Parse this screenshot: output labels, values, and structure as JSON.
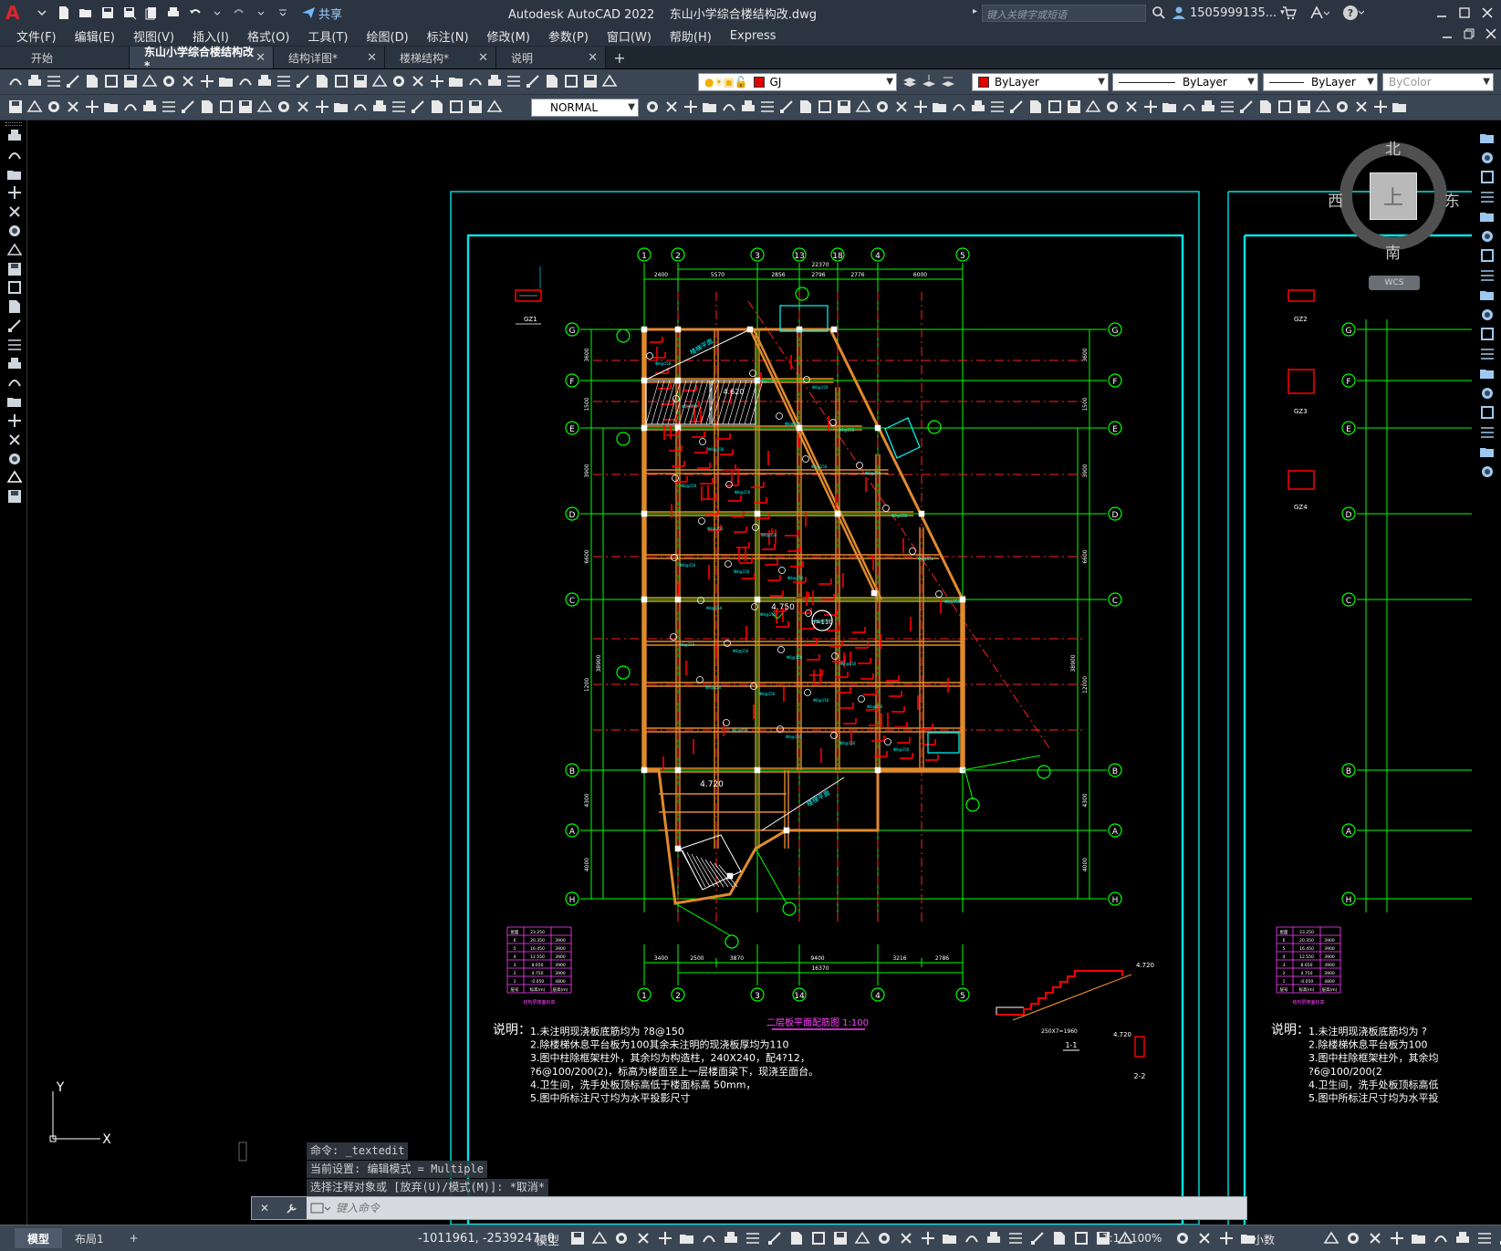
{
  "window": {
    "app_letter": "A",
    "title": "Autodesk AutoCAD 2022    东山小学综合楼结构改.dwg",
    "search_placeholder": "键入关键字或短语",
    "user": "1505999135...",
    "share": "共享"
  },
  "menu": [
    "文件(F)",
    "编辑(E)",
    "视图(V)",
    "插入(I)",
    "格式(O)",
    "工具(T)",
    "绘图(D)",
    "标注(N)",
    "修改(M)",
    "参数(P)",
    "窗口(W)",
    "帮助(H)",
    "Express"
  ],
  "tabs": [
    {
      "label": "开始",
      "active": false,
      "closable": false
    },
    {
      "label": "东山小学综合楼结构改*",
      "active": true,
      "closable": true
    },
    {
      "label": "结构详图*",
      "active": false,
      "closable": true
    },
    {
      "label": "楼梯结构*",
      "active": false,
      "closable": true
    },
    {
      "label": "说明",
      "active": false,
      "closable": true
    }
  ],
  "toolbar": {
    "layer": "GJ",
    "color": "ByLayer",
    "linetype": "ByLayer",
    "lineweight": "ByLayer",
    "plotstyle": "ByColor",
    "dimstyle": "NORMAL"
  },
  "colors": {
    "frame_cyan": "#00e5e5",
    "grid_green": "#00ff00",
    "beam_orange": "#e08a2c",
    "axis_red": "#ff2020",
    "rebar_red": "#ff0000",
    "annot_cyan": "#00ffff",
    "table_magenta": "#ff40ff",
    "note_white": "#ffffff"
  },
  "viewcube": {
    "north": "北",
    "south": "南",
    "east": "东",
    "west": "西",
    "top": "上",
    "wcs": "WCS"
  },
  "drawing": {
    "title": "二层板平面配筋图  1:100",
    "grid_top": [
      "1",
      "2",
      "3",
      "13",
      "18",
      "4",
      "5"
    ],
    "grid_bottom": [
      "1",
      "2",
      "3",
      "4",
      "14",
      "5"
    ],
    "grid_rows": [
      "G",
      "F",
      "E",
      "D",
      "C",
      "B",
      "A",
      "H"
    ],
    "dims_top": [
      "2400",
      "5570",
      "2856",
      "2796",
      "2776",
      "6000"
    ],
    "dims_top_total": "22370",
    "dims_bottom": [
      "3400",
      "2500",
      "3870",
      "9400",
      "3216",
      "2786"
    ],
    "dims_bottom_total": "16370",
    "dims_left": [
      "3600",
      "1500",
      "3900",
      "6600",
      "1200",
      "4300",
      "4000"
    ],
    "dims_right": [
      "3600",
      "1500",
      "3900",
      "6600",
      "12000",
      "4300",
      "4000"
    ],
    "dims_left_total": "38900",
    "elev": [
      "4.750",
      "4.720",
      "4.620"
    ],
    "thickness_label": "h=110",
    "stair_label": "楼梯平面",
    "column_tags_left": [
      "GZ1"
    ],
    "column_tags_right": [
      "GZ2",
      "GZ3",
      "GZ4"
    ],
    "notes_label": "说明：",
    "notes": [
      "1.未注明现浇板底筋均为 ?8@150",
      "2.除楼梯休息平台板为100其余未注明的现浇板厚均为110",
      "3.图中柱除框架柱外，其余均为构造柱，240X240，配4?12，",
      "  ?6@100/200(2)，标高为楼面至上一层楼面梁下，现浇至面台。",
      "4.卫生间，洗手处板顶标高低于楼面标高 50mm，",
      "5.图中所标注尺寸均为水平投影尺寸"
    ],
    "section_labels": [
      "1-1",
      "2-2"
    ],
    "stair_dims": [
      "250X7=1960",
      "2400",
      "4.720"
    ],
    "table_title": "结构层楼面标高",
    "table_rows": [
      [
        "屋面",
        "23.250",
        ""
      ],
      [
        "6",
        "20.350",
        "3900"
      ],
      [
        "5",
        "16.450",
        "3900"
      ],
      [
        "4",
        "12.550",
        "3900"
      ],
      [
        "3",
        "8.650",
        "3900"
      ],
      [
        "2",
        "4.750",
        "3900"
      ],
      [
        "1",
        "-0.050",
        "4800"
      ],
      [
        "层号",
        "标高(m)",
        "层高(m)"
      ]
    ]
  },
  "command": {
    "history": [
      "命令: _textedit",
      "当前设置: 编辑模式 = Multiple",
      "选择注释对象或 [放弃(U)/模式(M)]: *取消*"
    ],
    "placeholder": "键入命令"
  },
  "layout_tabs": [
    "模型",
    "布局1"
  ],
  "status": {
    "coords": "-1011961, -2539247, 0",
    "model": "模型",
    "scale": "1:1 / 100%",
    "units": "小数"
  }
}
